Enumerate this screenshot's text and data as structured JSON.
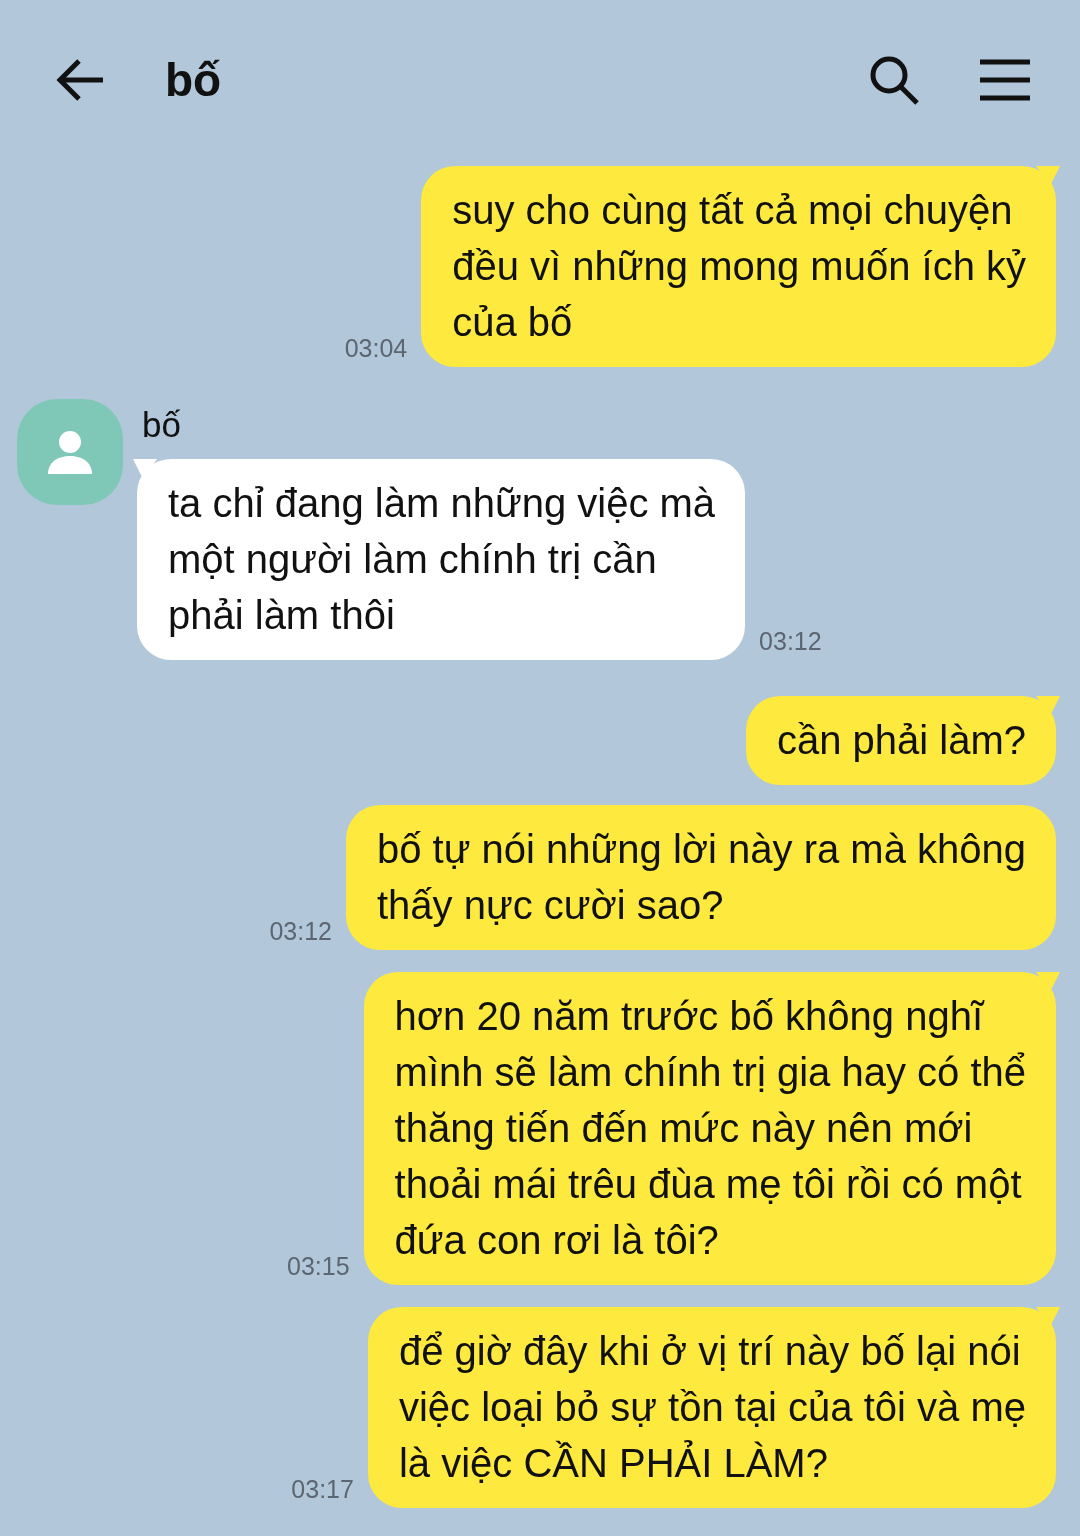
{
  "header": {
    "title": "bố"
  },
  "messages": [
    {
      "kind": "outgoing",
      "tail": true,
      "lines": [
        "suy cho cùng tất cả mọi chuyện",
        "đều vì những mong muốn ích kỷ",
        "của bố"
      ],
      "time": "03:04"
    },
    {
      "kind": "incoming",
      "tail": true,
      "sender": "bố",
      "lines": [
        "ta chỉ đang làm những việc mà",
        "một người làm chính trị cần",
        "phải làm thôi"
      ],
      "time": "03:12"
    },
    {
      "kind": "outgoing",
      "tail": true,
      "lines": [
        "cần phải làm?"
      ]
    },
    {
      "kind": "outgoing",
      "tail": false,
      "lines": [
        "bố tự nói những lời này ra mà không",
        "thấy nực cười sao?"
      ],
      "time": "03:12"
    },
    {
      "kind": "outgoing",
      "tail": true,
      "lines": [
        "hơn 20 năm trước bố không nghĩ",
        "mình sẽ làm chính trị gia hay có thể",
        "thăng tiến đến mức này nên mới",
        "thoải mái trêu đùa mẹ tôi rồi có một",
        "đứa con rơi là tôi?"
      ],
      "time": "03:15"
    },
    {
      "kind": "outgoing",
      "tail": true,
      "lines": [
        "để giờ đây khi ở vị trí này bố lại nói",
        "việc loại bỏ sự tồn tại của tôi và mẹ",
        "là việc CẦN PHẢI LÀM?"
      ],
      "time": "03:17"
    }
  ]
}
